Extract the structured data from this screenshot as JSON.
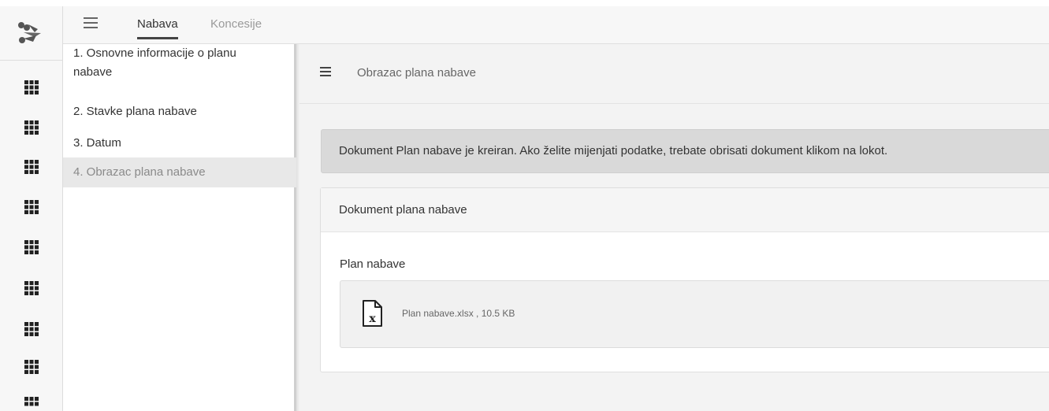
{
  "topbar": {
    "tabs": [
      {
        "label": "Nabava",
        "active": true
      },
      {
        "label": "Koncesije",
        "active": false
      }
    ]
  },
  "rail": {
    "logo_icon": "chevron-logo",
    "items": [
      "grid-icon",
      "grid-icon",
      "grid-icon",
      "grid-icon",
      "grid-icon",
      "grid-icon",
      "grid-icon",
      "grid-icon",
      "grid-icon"
    ]
  },
  "steps": {
    "items": [
      {
        "label_line1": "1. Osnovne informacije o planu",
        "label_line2": "nabave"
      },
      {
        "label": "2. Stavke plana nabave"
      },
      {
        "label": "3. Datum"
      },
      {
        "label": "4. Obrazac plana nabave",
        "active": true
      }
    ]
  },
  "main": {
    "title": "Obrazac plana nabave",
    "alert": "Dokument Plan nabave je kreiran. Ako želite mijenjati podatke, trebate obrisati dokument klikom na lokot.",
    "card": {
      "header": "Dokument plana nabave",
      "field_label": "Plan nabave",
      "file": {
        "name": "Plan nabave.xlsx , 10.5 KB",
        "icon": "excel-file-icon"
      }
    }
  },
  "colors": {
    "background": "#f3f3f3",
    "alert_bg": "#d9d9d9",
    "active_step_bg": "#e8e8e8"
  }
}
